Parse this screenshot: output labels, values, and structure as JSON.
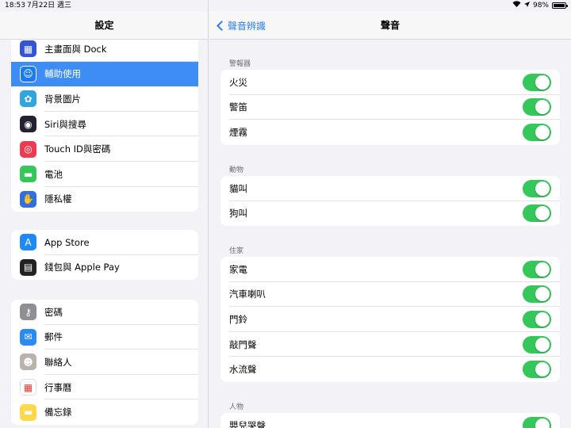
{
  "status": {
    "time": "18:53",
    "date": "7月22日 週三",
    "battery": "98%",
    "battery_level": 0.98
  },
  "colors": {
    "accent": "#2f7cf6",
    "toggle_on": "#34c759",
    "selected_row": "#3d8df5"
  },
  "sidebar": {
    "title": "設定",
    "groups": [
      {
        "items": [
          {
            "label": "主畫面與 Dock",
            "icon": "grid-icon",
            "color": "#3553d6",
            "glyph": "▦"
          },
          {
            "label": "輔助使用",
            "icon": "accessibility-icon",
            "color": "#1a7bf2",
            "glyph": "☺",
            "selected": true
          },
          {
            "label": "背景圖片",
            "icon": "flower-icon",
            "color": "#2fa6de",
            "glyph": "✿"
          },
          {
            "label": "Siri與搜尋",
            "icon": "siri-icon",
            "color": "#222233",
            "glyph": "◉"
          },
          {
            "label": "Touch ID與密碼",
            "icon": "fingerprint-icon",
            "color": "#ee3b52",
            "glyph": "◎"
          },
          {
            "label": "電池",
            "icon": "battery-icon",
            "color": "#35c759",
            "glyph": "▬"
          },
          {
            "label": "隱私權",
            "icon": "hand-icon",
            "color": "#2f6fe0",
            "glyph": "✋"
          }
        ]
      },
      {
        "items": [
          {
            "label": "App Store",
            "icon": "app-store-icon",
            "color": "#1f8af5",
            "glyph": "A"
          },
          {
            "label": "錢包與 Apple Pay",
            "icon": "wallet-icon",
            "color": "#222222",
            "glyph": "▤"
          }
        ]
      },
      {
        "items": [
          {
            "label": "密碼",
            "icon": "key-icon",
            "color": "#8e8e93",
            "glyph": "⚷"
          },
          {
            "label": "郵件",
            "icon": "mail-icon",
            "color": "#2c8bf0",
            "glyph": "✉"
          },
          {
            "label": "聯絡人",
            "icon": "contacts-icon",
            "color": "#b9b4ab",
            "glyph": "☻"
          },
          {
            "label": "行事曆",
            "icon": "calendar-icon",
            "color": "#ffffff",
            "glyph": "▦",
            "glyph_color": "#e33b30"
          },
          {
            "label": "備忘錄",
            "icon": "notes-icon",
            "color": "#ffd84a",
            "glyph": "▬"
          }
        ]
      }
    ]
  },
  "main": {
    "back_label": "聲音辨識",
    "title": "聲音",
    "sections": [
      {
        "title": "警報器",
        "items": [
          {
            "label": "火災",
            "on": true
          },
          {
            "label": "警笛",
            "on": true
          },
          {
            "label": "煙霧",
            "on": true
          }
        ]
      },
      {
        "title": "動物",
        "items": [
          {
            "label": "貓叫",
            "on": true
          },
          {
            "label": "狗叫",
            "on": true
          }
        ]
      },
      {
        "title": "住家",
        "items": [
          {
            "label": "家電",
            "on": true
          },
          {
            "label": "汽車喇叭",
            "on": true
          },
          {
            "label": "門鈴",
            "on": true
          },
          {
            "label": "敲門聲",
            "on": true
          },
          {
            "label": "水流聲",
            "on": true
          }
        ]
      },
      {
        "title": "人物",
        "items": [
          {
            "label": "嬰兒哭聲",
            "on": true
          }
        ]
      }
    ]
  }
}
